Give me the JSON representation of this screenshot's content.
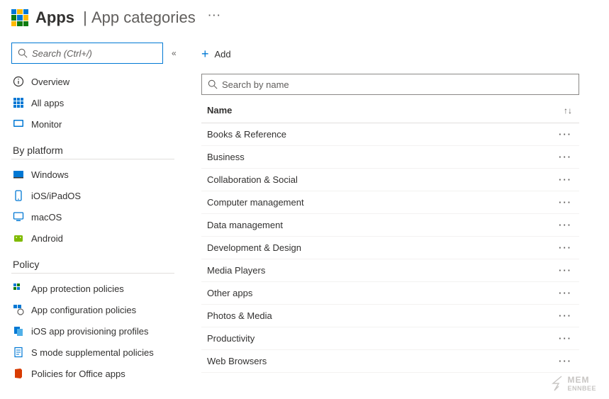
{
  "header": {
    "title": "Apps",
    "subtitle": "App categories"
  },
  "sidebar": {
    "search_placeholder": "Search (Ctrl+/)",
    "top": [
      {
        "label": "Overview"
      },
      {
        "label": "All apps"
      },
      {
        "label": "Monitor"
      }
    ],
    "platform_heading": "By platform",
    "platforms": [
      {
        "label": "Windows"
      },
      {
        "label": "iOS/iPadOS"
      },
      {
        "label": "macOS"
      },
      {
        "label": "Android"
      }
    ],
    "policy_heading": "Policy",
    "policies": [
      {
        "label": "App protection policies"
      },
      {
        "label": "App configuration policies"
      },
      {
        "label": "iOS app provisioning profiles"
      },
      {
        "label": "S mode supplemental policies"
      },
      {
        "label": "Policies for Office apps"
      }
    ]
  },
  "toolbar": {
    "add_label": "Add"
  },
  "filter": {
    "placeholder": "Search by name"
  },
  "column": {
    "name": "Name"
  },
  "categories": [
    {
      "name": "Books & Reference"
    },
    {
      "name": "Business"
    },
    {
      "name": "Collaboration & Social"
    },
    {
      "name": "Computer management"
    },
    {
      "name": "Data management"
    },
    {
      "name": "Development & Design"
    },
    {
      "name": "Media Players"
    },
    {
      "name": "Other apps"
    },
    {
      "name": "Photos & Media"
    },
    {
      "name": "Productivity"
    },
    {
      "name": "Web Browsers"
    }
  ],
  "watermark": {
    "line1": "MEM",
    "line2": "ENNBEE"
  }
}
